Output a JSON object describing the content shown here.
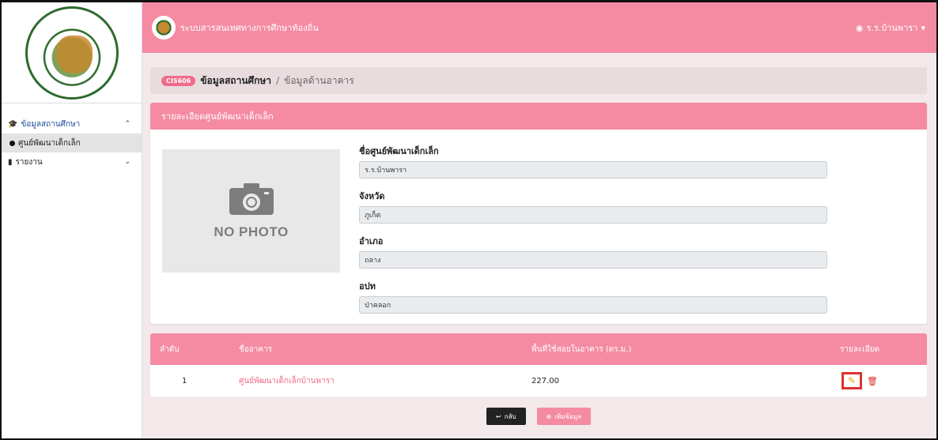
{
  "app": {
    "title": "ระบบสารสนเทศทางการศึกษาท้องถิ่น",
    "user": "ร.ร.บ้านพารา"
  },
  "sidebar": {
    "items": [
      {
        "label": "ข้อมูลสถานศึกษา",
        "icon": "graduation-cap-icon"
      },
      {
        "label": "ศูนย์พัฒนาเด็กเล็ก",
        "icon": "dot-icon"
      },
      {
        "label": "รายงาน",
        "icon": "document-icon"
      }
    ]
  },
  "breadcrumb": {
    "badge": "CIS606",
    "main": "ข้อมูลสถานศึกษา",
    "separator": "/",
    "current": "ข้อมูลด้านอาคาร"
  },
  "card": {
    "title": "รายละเอียดศูนย์พัฒนาเด็กเล็ก",
    "no_photo": "NO PHOTO",
    "fields": [
      {
        "label": "ชื่อศูนย์พัฒนาเด็กเล็ก",
        "value": "ร.ร.บ้านพารา"
      },
      {
        "label": "จังหวัด",
        "value": "ภูเก็ต"
      },
      {
        "label": "อำเภอ",
        "value": "ถลาง"
      },
      {
        "label": "อปท",
        "value": "ป่าคลอก"
      }
    ]
  },
  "table": {
    "headers": [
      "ลำดับ",
      "ชื่ออาคาร",
      "พื้นที่ใช้สอยในอาคาร (ตร.ม.)",
      "รายละเอียด"
    ],
    "rows": [
      {
        "no": "1",
        "name": "ศูนย์พัฒนาเด็กเล็กบ้านพารา",
        "area": "227.00"
      }
    ]
  },
  "buttons": {
    "back": "กลับ",
    "add": "เพิ่มข้อมูล"
  },
  "colors": {
    "primary": "#f48ba3",
    "accent": "#f06b8a",
    "danger": "#e0312c"
  }
}
